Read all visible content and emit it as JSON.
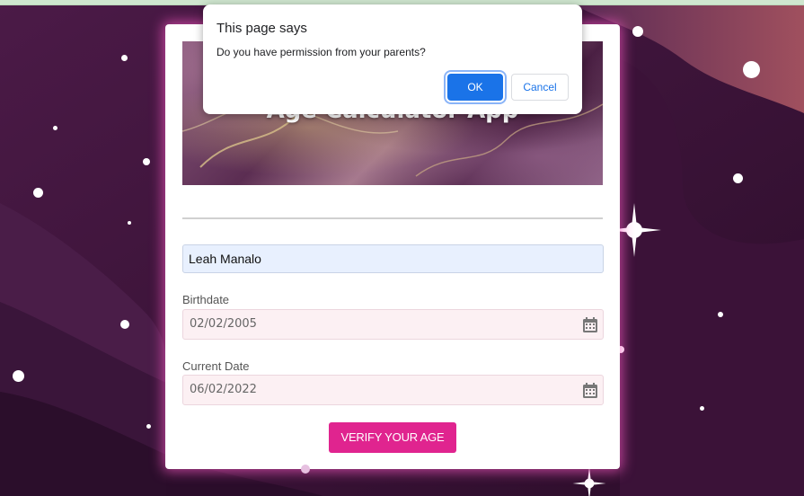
{
  "dialog": {
    "title": "This page says",
    "message": "Do you have permission from your parents?",
    "ok_label": "OK",
    "cancel_label": "Cancel"
  },
  "app": {
    "title": "Age Calculator App",
    "name_value": "Leah Manalo",
    "birthdate_label": "Birthdate",
    "birthdate_value": "02/02/2005",
    "current_date_label": "Current Date",
    "current_date_value": "06/02/2022",
    "verify_label": "VERIFY YOUR AGE"
  },
  "icons": {
    "calendar": "calendar-icon",
    "sparkle": "sparkle-star-icon"
  },
  "colors": {
    "accent": "#e0248f",
    "dialog_ok": "#1a73e8",
    "background": "#3a1438"
  }
}
